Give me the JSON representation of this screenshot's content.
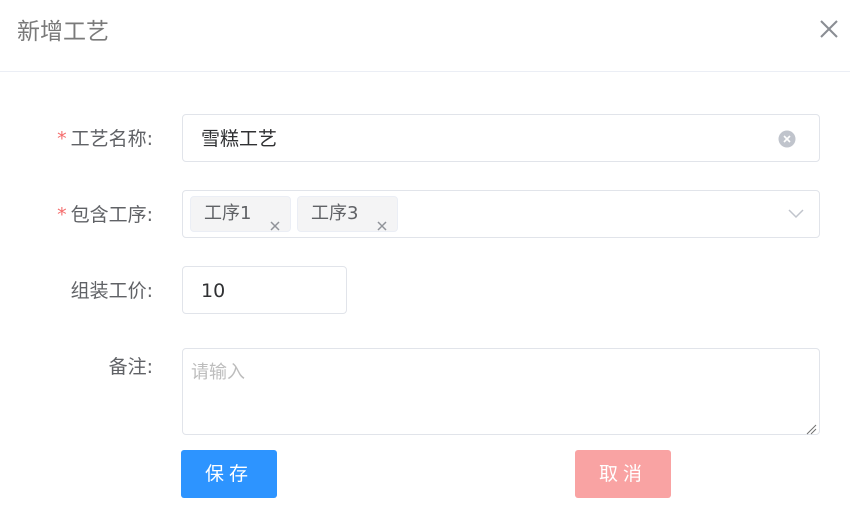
{
  "dialog": {
    "title": "新增工艺",
    "close_icon": "close-icon"
  },
  "form": {
    "name": {
      "required": true,
      "label": "工艺名称:",
      "value": "雪糕工艺",
      "clear_icon": "circle-x-icon"
    },
    "steps": {
      "required": true,
      "label": "包含工序:",
      "tags": [
        {
          "text": "工序1"
        },
        {
          "text": "工序3"
        }
      ],
      "dropdown_icon": "chevron-down-icon"
    },
    "price": {
      "required": false,
      "label": "组装工价:",
      "value": "10"
    },
    "remark": {
      "required": false,
      "label": "备注:",
      "placeholder": "请输入",
      "value": ""
    }
  },
  "actions": {
    "save_label": "保存",
    "cancel_label": "取消",
    "save_color": "#2d94ff",
    "cancel_color": "#f9a3a3"
  },
  "colors": {
    "required_mark": "#f56c6c",
    "border": "#e1e4ea"
  }
}
